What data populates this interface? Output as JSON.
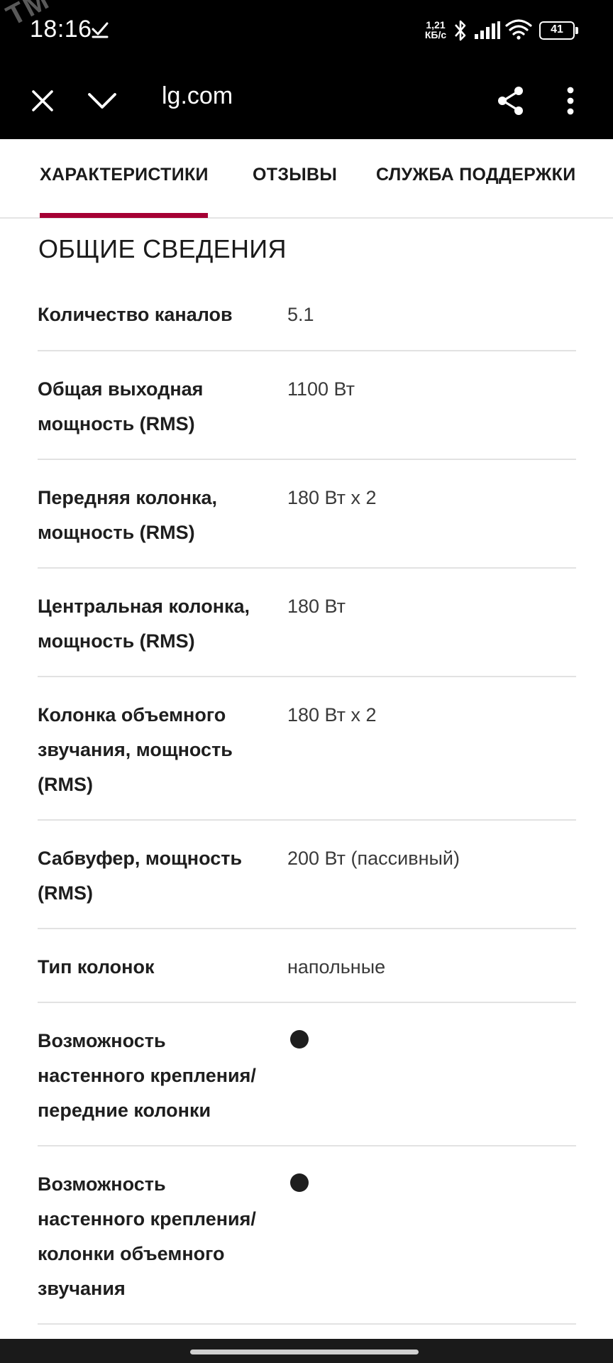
{
  "status_bar": {
    "watermark": "TM",
    "time": "18:16",
    "net_speed_value": "1,21",
    "net_speed_unit": "КБ/с",
    "battery": "41",
    "color": "#000000"
  },
  "toolbar": {
    "url": "lg.com",
    "close_icon": "close-icon",
    "minimize_icon": "chevron-down-icon",
    "share_icon": "share-icon",
    "menu_icon": "more-vertical-icon"
  },
  "tabs": [
    {
      "label": "ХАРАКТЕРИСТИКИ",
      "active": true
    },
    {
      "label": "ОТЗЫВЫ",
      "active": false
    },
    {
      "label": "СЛУЖБА ПОДДЕРЖКИ",
      "active": false
    }
  ],
  "accent_color": "#a50034",
  "section": {
    "title": "ОБЩИЕ СВЕДЕНИЯ",
    "specs": [
      {
        "label": "Количество каналов",
        "value": "5.1"
      },
      {
        "label": "Общая выходная мощность (RMS)",
        "value": "1100 Вт"
      },
      {
        "label": "Передняя колонка, мощность (RMS)",
        "value": "180 Вт x 2"
      },
      {
        "label": "Центральная колонка, мощность (RMS)",
        "value": "180 Вт"
      },
      {
        "label": "Колонка объемного звучания, мощность (RMS)",
        "value": "180 Вт x 2"
      },
      {
        "label": "Сабвуфер, мощность (RMS)",
        "value": "200 Вт (пассивный)"
      },
      {
        "label": "Тип колонок",
        "value": "напольные"
      },
      {
        "label": "Возможность настенного крепления/ передние колонки",
        "value": "bullet-dot"
      },
      {
        "label": "Возможность настенного крепления/ колонки объемного звучания",
        "value": "bullet-dot"
      }
    ]
  }
}
